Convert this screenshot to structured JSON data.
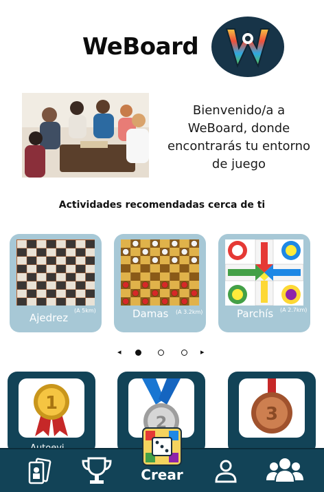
{
  "app": {
    "title": "WeBoard",
    "logo_icon": "weboard-w-logo"
  },
  "welcome": {
    "lines": [
      "Bienvenido/a a",
      "WeBoard, donde",
      "encontrarás tu entorno",
      "de juego"
    ],
    "photo": "friends-playing-board-game-photo"
  },
  "recommended": {
    "title": "Actividades recomendadas cerca de ti",
    "cards": [
      {
        "name": "Ajedrez",
        "distance": "(A 5km)",
        "icon": "chessboard"
      },
      {
        "name": "Damas",
        "distance": "(A 3.2km)",
        "icon": "checkers-board"
      },
      {
        "name": "Parchís",
        "distance": "(A 2.7km)",
        "icon": "parchis-board"
      }
    ],
    "pager": {
      "prev": "◂",
      "next": "▸",
      "active_index": 0,
      "count": 3
    }
  },
  "awards": [
    {
      "label": "Autoevi...",
      "medal": "gold-medal-1"
    },
    {
      "label": "",
      "medal": "silver-medal-2"
    },
    {
      "label": "",
      "medal": "bronze-medal-3"
    }
  ],
  "nav": {
    "items": [
      {
        "icon": "games-cards-icon"
      },
      {
        "icon": "trophy-icon"
      },
      {
        "icon": "profile-icon"
      },
      {
        "icon": "group-icon"
      }
    ],
    "create_label": "Crear"
  },
  "colors": {
    "dark_teal": "#124357",
    "card_blue": "#a7c8d6",
    "white": "#ffffff"
  }
}
